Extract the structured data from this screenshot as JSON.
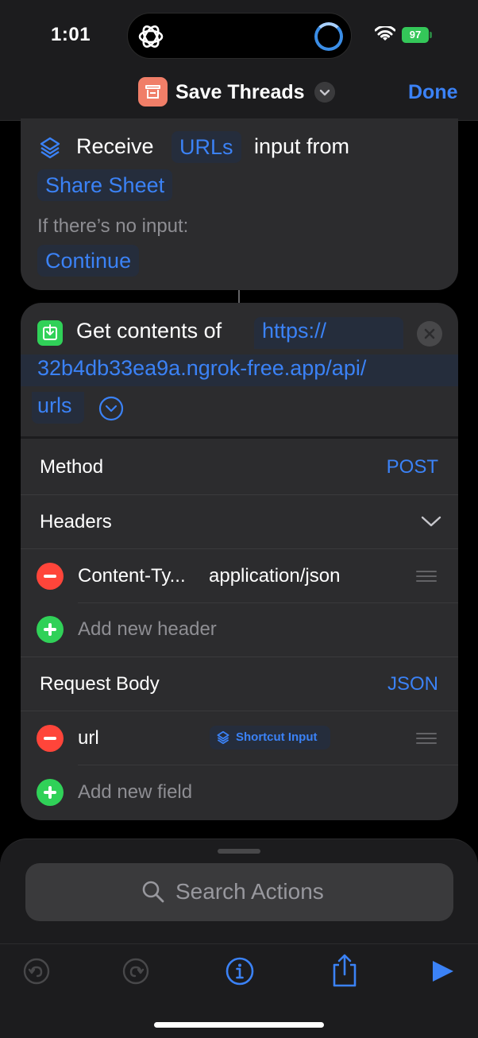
{
  "status_bar": {
    "time": "1:01",
    "battery": "97"
  },
  "nav": {
    "title": "Save Threads",
    "done_label": "Done"
  },
  "receive_action": {
    "verb": "Receive",
    "input_type": "URLs",
    "connector_text": "input from",
    "source": "Share Sheet",
    "no_input_label": "If there’s no input:",
    "no_input_value": "Continue"
  },
  "get_contents_action": {
    "title": "Get contents of",
    "url_line1": "https://",
    "url_line2": "32b4db33ea9a.ngrok-free.app/api/",
    "url_line3": "urls",
    "method_label": "Method",
    "method_value": "POST",
    "headers_label": "Headers",
    "headers": [
      {
        "key": "Content-Ty...",
        "value": "application/json"
      }
    ],
    "add_header_label": "Add new header",
    "body_label": "Request Body",
    "body_type": "JSON",
    "fields": [
      {
        "key": "url",
        "value": "Shortcut Input"
      }
    ],
    "add_field_label": "Add new field"
  },
  "sheet": {
    "search_placeholder": "Search Actions"
  },
  "colors": {
    "accent": "#3b82f6",
    "card": "#2c2c2e",
    "remove": "#ff453a",
    "add": "#30d158",
    "app_icon": "#f07e68"
  }
}
